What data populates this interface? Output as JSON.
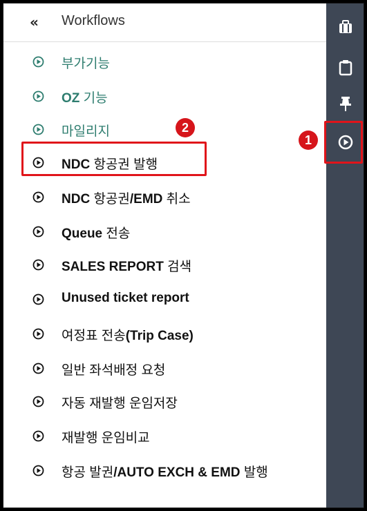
{
  "header": {
    "collapse_symbol": "«",
    "title": "Workflows"
  },
  "items": [
    {
      "parts": [
        {
          "t": "부가기능",
          "b": false
        }
      ],
      "style": "green"
    },
    {
      "parts": [
        {
          "t": "OZ",
          "b": true
        },
        {
          "t": " 기능",
          "b": false
        }
      ],
      "style": "green"
    },
    {
      "parts": [
        {
          "t": "마일리지",
          "b": false
        }
      ],
      "style": "green"
    },
    {
      "parts": [
        {
          "t": "NDC",
          "b": true
        },
        {
          "t": " 항공권 발행",
          "b": false
        }
      ],
      "style": "dark"
    },
    {
      "parts": [
        {
          "t": "NDC",
          "b": true
        },
        {
          "t": " 항공권",
          "b": false
        },
        {
          "t": "/EMD",
          "b": true
        },
        {
          "t": " 취소",
          "b": false
        }
      ],
      "style": "dark"
    },
    {
      "parts": [
        {
          "t": "Queue",
          "b": true
        },
        {
          "t": " 전송",
          "b": false
        }
      ],
      "style": "dark"
    },
    {
      "parts": [
        {
          "t": "SALES REPORT",
          "b": true
        },
        {
          "t": " 검색",
          "b": false
        }
      ],
      "style": "dark"
    },
    {
      "parts": [
        {
          "t": "Unused ticket report",
          "b": true
        }
      ],
      "style": "dark"
    },
    {
      "parts": [
        {
          "t": "여정표 전송",
          "b": false
        },
        {
          "t": "(Trip Case)",
          "b": true
        }
      ],
      "style": "dark"
    },
    {
      "parts": [
        {
          "t": "일반 좌석배정 요청",
          "b": false
        }
      ],
      "style": "dark"
    },
    {
      "parts": [
        {
          "t": "자동 재발행 운임저장",
          "b": false
        }
      ],
      "style": "dark"
    },
    {
      "parts": [
        {
          "t": "재발행 운임비교",
          "b": false
        }
      ],
      "style": "dark"
    },
    {
      "parts": [
        {
          "t": "항공 발권",
          "b": false
        },
        {
          "t": "/AUTO EXCH & EMD",
          "b": true
        },
        {
          "t": " 발행",
          "b": false
        }
      ],
      "style": "dark"
    }
  ],
  "sidebar": [
    {
      "icon": "briefcase-icon"
    },
    {
      "icon": "clipboard-icon"
    },
    {
      "icon": "pin-icon"
    },
    {
      "icon": "play-circle-icon"
    }
  ],
  "annotations": {
    "badge_1": "1",
    "badge_2": "2",
    "highlight_color": "#e0141a"
  },
  "colors": {
    "sidebar_bg": "#3e4755",
    "green_text": "#2e7d6f",
    "dark_text": "#111111"
  }
}
